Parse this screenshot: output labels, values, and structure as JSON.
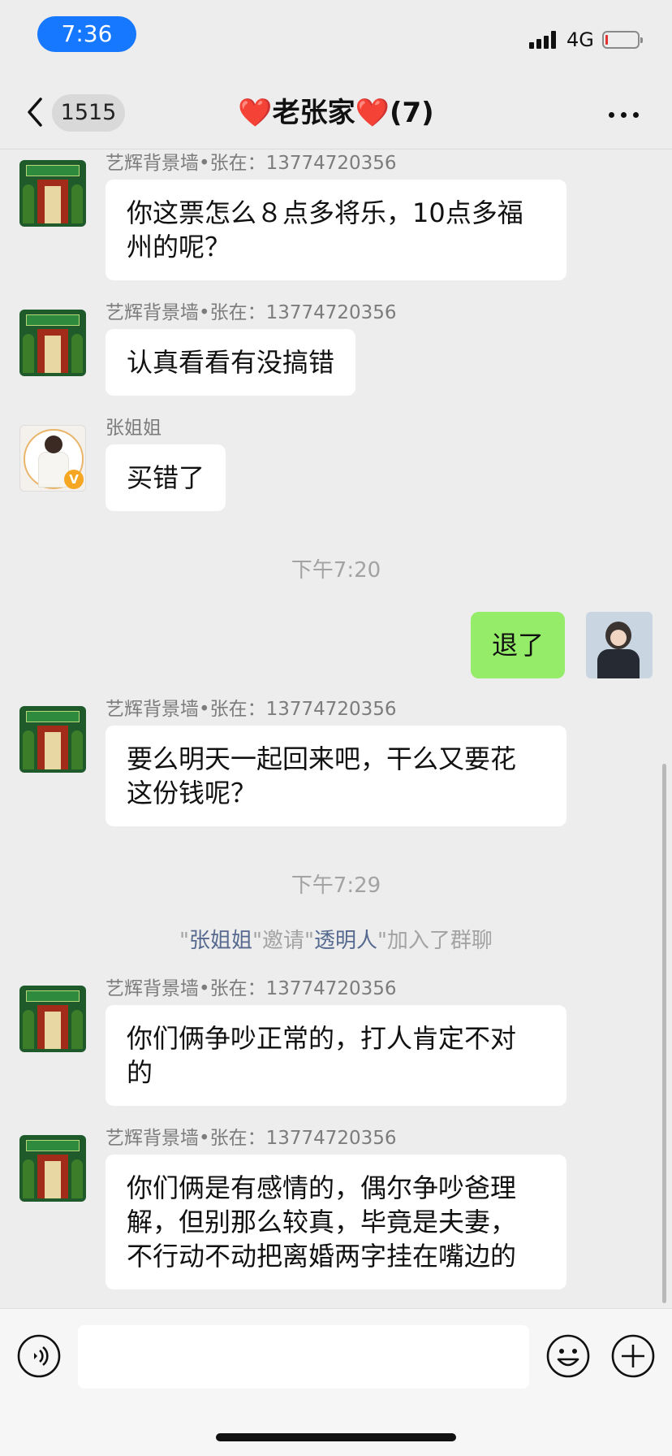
{
  "status_bar": {
    "time": "7:36",
    "network": "4G"
  },
  "nav": {
    "unread_count": "1515",
    "title": "❤️老张家❤️(7)"
  },
  "messages": [
    {
      "sender": "艺辉背景墙•张在：13774720356",
      "text_l1": "你这票怎么８点多将乐，10点多福",
      "text_l2": "州的呢？"
    },
    {
      "sender": "艺辉背景墙•张在：13774720356",
      "text": "认真看看有没搞错"
    },
    {
      "sender": "张姐姐",
      "text": "买错了"
    },
    {
      "timestamp": "下午7:20"
    },
    {
      "text": "退了"
    },
    {
      "sender": "艺辉背景墙•张在：13774720356",
      "text_l1": "要么明天一起回来吧，干么又要花",
      "text_l2": "这份钱呢？"
    },
    {
      "timestamp": "下午7:29"
    },
    {
      "system": {
        "q1": "\"",
        "name1": "张姐姐",
        "mid": "\"邀请\"",
        "name2": "透明人",
        "end": "\"加入了群聊"
      }
    },
    {
      "sender": "艺辉背景墙•张在：13774720356",
      "text_l1": "你们俩争吵正常的，打人肯定不对",
      "text_l2": "的"
    },
    {
      "sender": "艺辉背景墙•张在：13774720356",
      "text_l1": "你们俩是有感情的，偶尔争吵爸理",
      "text_l2": "解，但别那么较真，毕竟是夫妻，",
      "text_l3": "不行动不动把离婚两字挂在嘴边的"
    }
  ],
  "colors": {
    "mine_bubble": "#95ec69",
    "link": "#56698f",
    "time_pill": "#1677ff"
  }
}
